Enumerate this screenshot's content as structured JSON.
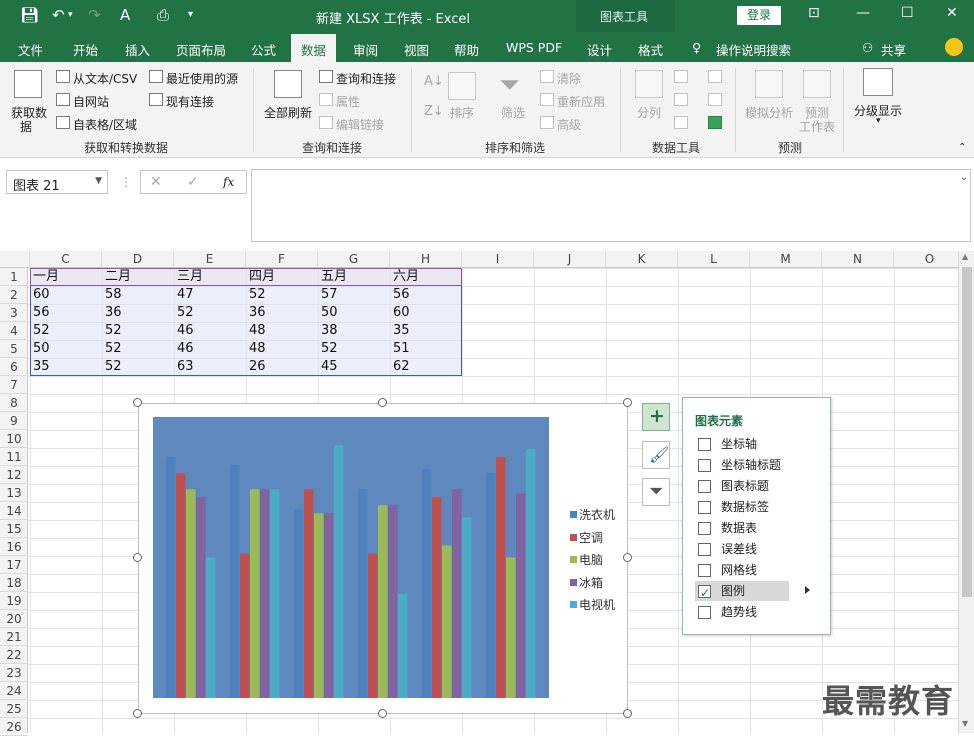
{
  "title_bar": {
    "document_title": "新建 XLSX 工作表  -  Excel",
    "contextual_tab_group": "图表工具",
    "login_label": "登录"
  },
  "tabs": [
    "文件",
    "开始",
    "插入",
    "页面布局",
    "公式",
    "数据",
    "审阅",
    "视图",
    "帮助",
    "WPS PDF",
    "设计",
    "格式"
  ],
  "active_tab": "数据",
  "tell_me": "操作说明搜索",
  "share": "共享",
  "ribbon": {
    "get_data": {
      "big_button": [
        "获取数",
        "据"
      ],
      "items": [
        "从文本/CSV",
        "自网站",
        "自表格/区域",
        "最近使用的源",
        "现有连接"
      ],
      "group_label": "获取和转换数据"
    },
    "queries": {
      "big_button": "全部刷新",
      "items": [
        "查询和连接",
        "属性",
        "编辑链接"
      ],
      "group_label": "查询和连接"
    },
    "sort_filter": {
      "sort": "排序",
      "filter": "筛选",
      "items": [
        "清除",
        "重新应用",
        "高级"
      ],
      "group_label": "排序和筛选"
    },
    "data_tools": {
      "split": "分列",
      "group_label": "数据工具"
    },
    "forecast": {
      "what_if": "模拟分析",
      "forecast_sheet": [
        "预测",
        "工作表"
      ],
      "group_label": "预测"
    },
    "outline": {
      "label": "分级显示"
    }
  },
  "formula_bar": {
    "name_box": "图表 21",
    "fx": "fx",
    "formula": ""
  },
  "columns": [
    "C",
    "D",
    "E",
    "F",
    "G",
    "H",
    "I",
    "J",
    "K",
    "L",
    "M",
    "N",
    "O"
  ],
  "rows": [
    "1",
    "2",
    "3",
    "4",
    "5",
    "6",
    "7",
    "8",
    "9",
    "10",
    "11",
    "12",
    "13",
    "14",
    "15",
    "16",
    "17",
    "18",
    "19",
    "20",
    "21",
    "22",
    "23",
    "24",
    "25",
    "26"
  ],
  "table": {
    "headers": [
      "一月",
      "二月",
      "三月",
      "四月",
      "五月",
      "六月"
    ],
    "rows": [
      [
        "60",
        "58",
        "47",
        "52",
        "57",
        "56"
      ],
      [
        "56",
        "36",
        "52",
        "36",
        "50",
        "60"
      ],
      [
        "52",
        "52",
        "46",
        "48",
        "38",
        "35"
      ],
      [
        "50",
        "52",
        "46",
        "48",
        "52",
        "51"
      ],
      [
        "35",
        "52",
        "63",
        "26",
        "45",
        "62"
      ]
    ]
  },
  "chart_data": {
    "type": "bar",
    "categories": [
      "一月",
      "二月",
      "三月",
      "四月",
      "五月",
      "六月"
    ],
    "series": [
      {
        "name": "洗衣机",
        "color": "#4f81bd",
        "values": [
          60,
          58,
          47,
          52,
          57,
          56
        ]
      },
      {
        "name": "空调",
        "color": "#c0504d",
        "values": [
          56,
          36,
          52,
          36,
          50,
          60
        ]
      },
      {
        "name": "电脑",
        "color": "#9bbb59",
        "values": [
          52,
          52,
          46,
          48,
          38,
          35
        ]
      },
      {
        "name": "冰箱",
        "color": "#8064a2",
        "values": [
          50,
          52,
          46,
          48,
          52,
          51
        ]
      },
      {
        "name": "电视机",
        "color": "#4bacc6",
        "values": [
          35,
          52,
          63,
          26,
          45,
          62
        ]
      }
    ],
    "ylim": [
      0,
      70
    ],
    "background": "#5f88bf",
    "legend_position": "right",
    "grid": false
  },
  "chart_elements": {
    "title": "图表元素",
    "items": [
      {
        "label": "坐标轴",
        "checked": false
      },
      {
        "label": "坐标轴标题",
        "checked": false
      },
      {
        "label": "图表标题",
        "checked": false
      },
      {
        "label": "数据标签",
        "checked": false
      },
      {
        "label": "数据表",
        "checked": false
      },
      {
        "label": "误差线",
        "checked": false
      },
      {
        "label": "网格线",
        "checked": false
      },
      {
        "label": "图例",
        "checked": true
      },
      {
        "label": "趋势线",
        "checked": false
      }
    ]
  },
  "watermark": "最需教育"
}
